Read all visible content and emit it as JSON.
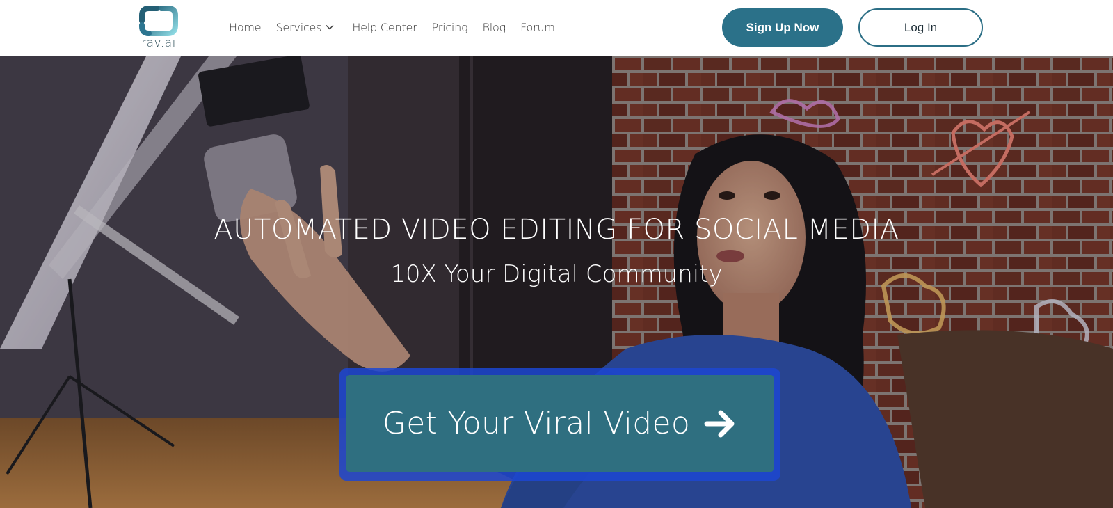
{
  "brand": {
    "name": "rav.ai",
    "logo_icon": "rounded-square-logo-icon",
    "colors": {
      "primary": "#2b7189",
      "logo_gradient_start": "#2a6f86",
      "logo_gradient_end": "#86d6e0"
    }
  },
  "nav": {
    "items": [
      {
        "label": "Home"
      },
      {
        "label": "Services",
        "icon": "chevron-down-icon"
      },
      {
        "label": "Help Center"
      },
      {
        "label": "Pricing"
      },
      {
        "label": "Blog"
      },
      {
        "label": "Forum"
      }
    ],
    "signup_label": "Sign Up Now",
    "login_label": "Log In"
  },
  "hero": {
    "title": "AUTOMATED VIDEO EDITING FOR SOCIAL MEDIA",
    "subtitle": "10X Your Digital Community",
    "background": "photo-woman-filming-with-phone-ring-light-brick-wall",
    "cta": {
      "label": "Get Your Viral Video",
      "icon": "arrow-right-icon",
      "colors": {
        "button": "#2f6f80",
        "glow": "#1c46d2"
      }
    }
  }
}
